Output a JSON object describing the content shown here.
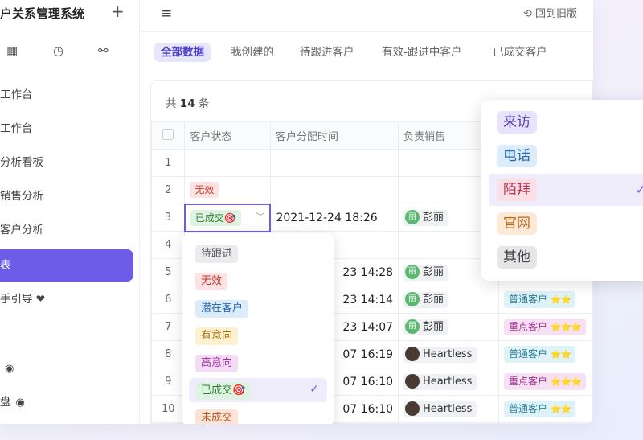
{
  "sidebar": {
    "brand": "户关系管理系统",
    "plus": "+",
    "items": [
      {
        "label": "工作台"
      },
      {
        "label": "工作台"
      },
      {
        "label": "分析看板"
      },
      {
        "label": "销售分析"
      },
      {
        "label": "客户分析"
      },
      {
        "label": "表"
      },
      {
        "label": "手引导 ❤"
      },
      {
        "label": ""
      },
      {
        "label": "盘"
      }
    ]
  },
  "header": {
    "back_label": "回到旧版"
  },
  "tabs": [
    "全部数据",
    "我创建的",
    "待跟进客户",
    "有效-跟进中客户",
    "已成交客户"
  ],
  "table": {
    "total_prefix": "共",
    "total_count": "14",
    "total_suffix": "条",
    "columns": [
      "客户状态",
      "客户分配时间",
      "负责销售"
    ],
    "rows": [
      {
        "n": "1",
        "status": "",
        "time": "",
        "sales": "",
        "type": ""
      },
      {
        "n": "2",
        "status": "无效",
        "time": "",
        "sales": "",
        "type": ""
      },
      {
        "n": "3",
        "status": "已成交🎯",
        "time": "2021-12-24 18:26",
        "sales": "彭丽",
        "avatar": "丽",
        "type": ""
      },
      {
        "n": "4",
        "status": "",
        "time": "",
        "sales": "",
        "type": ""
      },
      {
        "n": "5",
        "status": "",
        "time": "23 14:28",
        "sales": "彭丽",
        "avatar": "丽",
        "type": ""
      },
      {
        "n": "6",
        "status": "",
        "time": "23 14:14",
        "sales": "彭丽",
        "avatar": "丽",
        "type": "普通客户",
        "stars": "⭐⭐"
      },
      {
        "n": "7",
        "status": "",
        "time": "23 14:07",
        "sales": "彭丽",
        "avatar": "丽",
        "type": "重点客户",
        "stars": "⭐⭐⭐"
      },
      {
        "n": "8",
        "status": "",
        "time": "07 16:19",
        "sales": "Heartless",
        "avatar": "",
        "type": "普通客户",
        "stars": "⭐⭐"
      },
      {
        "n": "9",
        "status": "",
        "time": "07 16:10",
        "sales": "Heartless",
        "avatar": "",
        "type": "重点客户",
        "stars": "⭐⭐⭐"
      },
      {
        "n": "10",
        "status": "",
        "time": "07 16:10",
        "sales": "Heartless",
        "avatar": "",
        "type": "普通客户",
        "stars": "⭐⭐"
      }
    ]
  },
  "status_dropdown": {
    "options": [
      "待跟进",
      "无效",
      "潜在客户",
      "有意向",
      "高意向",
      "已成交🎯",
      "未成交"
    ],
    "selected": "已成交🎯"
  },
  "source_dropdown": {
    "options": [
      "来访",
      "电话",
      "陌拜",
      "官网",
      "其他"
    ],
    "selected": "陌拜"
  },
  "icons": {
    "check": "✓",
    "hamburger": "≡",
    "chevron": "⌄",
    "eye": "👁"
  },
  "colors": {
    "accent": "#6c5ce7"
  }
}
